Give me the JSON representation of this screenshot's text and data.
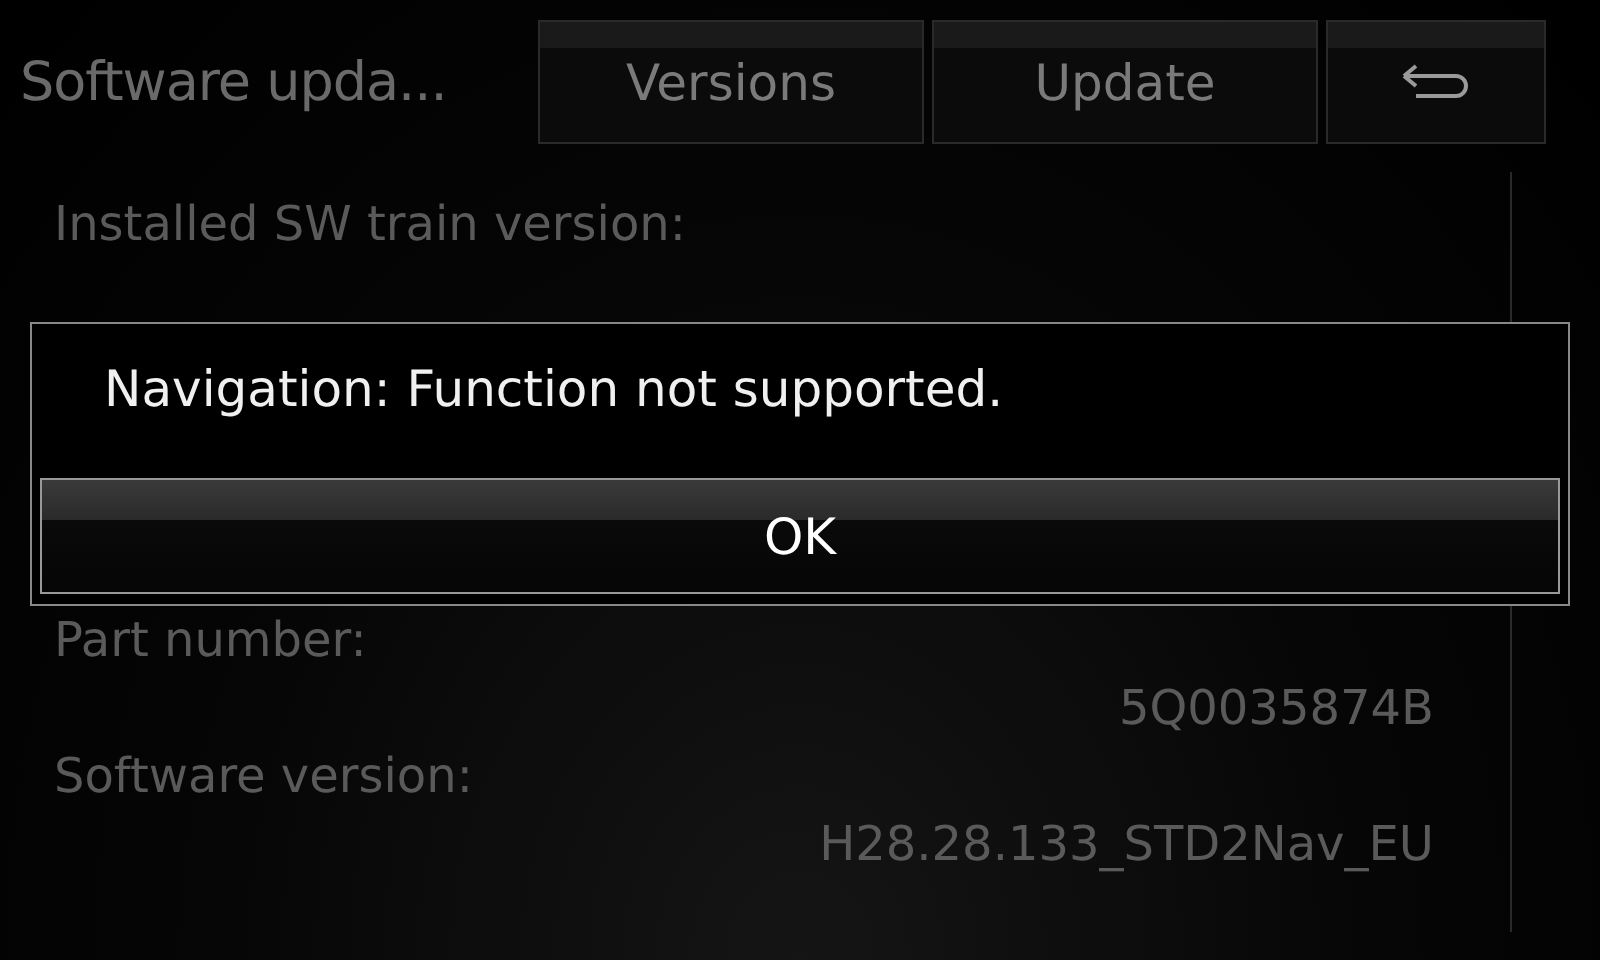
{
  "header": {
    "title": "Software upda...",
    "tabs": [
      {
        "kind": "text",
        "label": "Versions"
      },
      {
        "kind": "text",
        "label": "Update"
      },
      {
        "kind": "back"
      }
    ]
  },
  "details": [
    {
      "label": "Installed SW train version:"
    },
    {
      "label": "Part number:",
      "value": "5Q0035874B"
    },
    {
      "label": "Software version:",
      "value": "H28.28.133_STD2Nav_EU"
    }
  ],
  "dialog": {
    "message": "Navigation: Function not supported.",
    "button": "OK"
  }
}
